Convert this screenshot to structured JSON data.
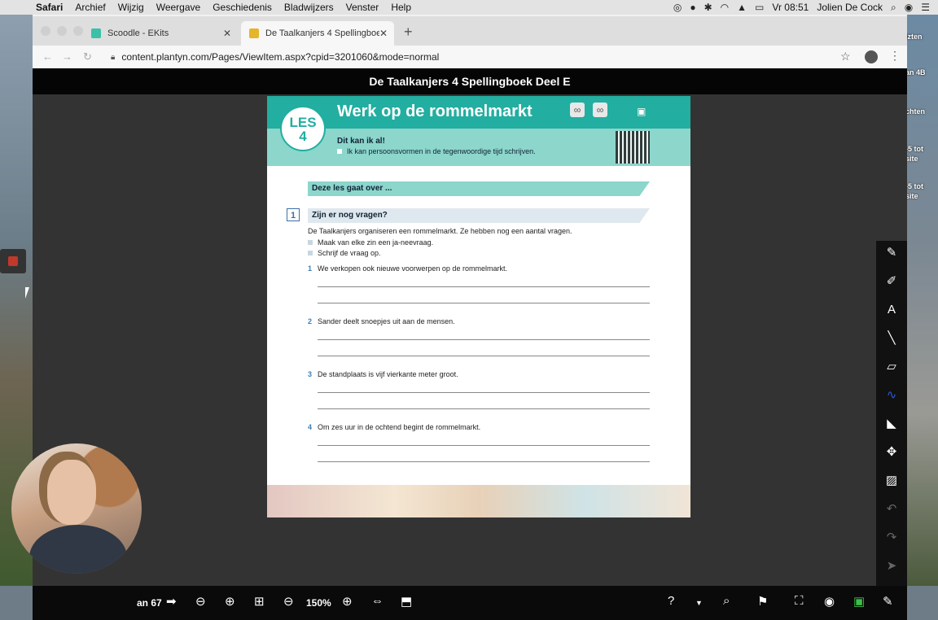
{
  "menubar": {
    "app": "Safari",
    "menus": [
      "Archief",
      "Wijzig",
      "Weergave",
      "Geschiedenis",
      "Bladwijzers",
      "Venster",
      "Help"
    ],
    "clock": "Vr 08:51",
    "user": "Jolien De Cock"
  },
  "tabs": [
    {
      "title": "Scoodle - EKits"
    },
    {
      "title": "De Taalkanjers 4 Spellingboek"
    }
  ],
  "address": {
    "url": "content.plantyn.com/Pages/ViewItem.aspx?cpid=3201060&mode=normal"
  },
  "viewer": {
    "title": "De Taalkanjers 4 Spellingboek Deel E",
    "page_label": "an 67",
    "zoom": "150%"
  },
  "page": {
    "les_label": "LES",
    "les_number": "4",
    "title": "Werk op de rommelmarkt",
    "kan_title": "Dit kan ik al!",
    "kan_item": "Ik kan persoonsvormen in de tegenwoordige tijd schrijven.",
    "section_bar": "Deze les gaat over ...",
    "exercise_number": "1",
    "exercise_title": "Zijn er nog vragen?",
    "intro": "De Taalkanjers organiseren een rommelmarkt. Ze hebben nog een aantal vragen.",
    "bullets": [
      "Maak van elke zin een ja-neevraag.",
      "Schrijf de vraag op."
    ],
    "questions": [
      {
        "n": "1",
        "text": "We verkopen ook nieuwe voorwerpen op de rommelmarkt."
      },
      {
        "n": "2",
        "text": "Sander deelt snoepjes uit aan de mensen."
      },
      {
        "n": "3",
        "text": "De standplaats is vijf vierkante meter groot."
      },
      {
        "n": "4",
        "text": "Om zes uur in de ochtend begint de rommelmarkt."
      }
    ]
  },
  "desktop_labels": [
    "izten",
    "an 4B",
    "chten",
    "-5 tot",
    "site",
    "-5 tot",
    "site"
  ],
  "colors": {
    "teal": "#22aea0",
    "light_teal": "#8cd6cc",
    "viewer_bg": "#333333",
    "accent_green": "#3bbf4a"
  }
}
